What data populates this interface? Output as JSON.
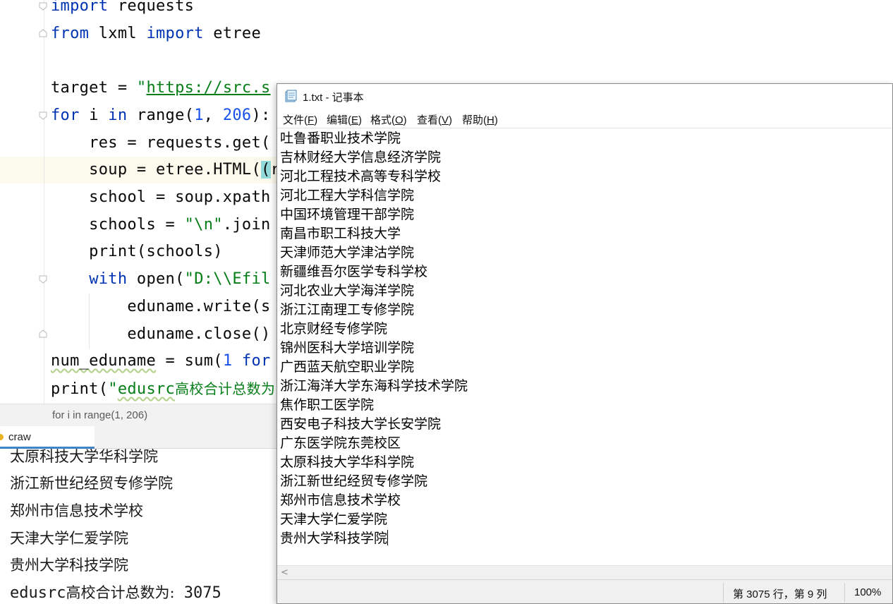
{
  "editor": {
    "lines": [
      [
        [
          "kw",
          "import"
        ],
        [
          "t",
          " requests"
        ]
      ],
      [
        [
          "kw",
          "from"
        ],
        [
          "t",
          " lxml "
        ],
        [
          "kw",
          "import"
        ],
        [
          "t",
          " etree"
        ]
      ],
      [],
      [
        [
          "t",
          "target = "
        ],
        [
          "str",
          "\""
        ],
        [
          "url",
          "https://src.s"
        ]
      ],
      [
        [
          "kw",
          "for"
        ],
        [
          "t",
          " i "
        ],
        [
          "kw",
          "in"
        ],
        [
          "t",
          " range("
        ],
        [
          "num",
          "1"
        ],
        [
          "t",
          ", "
        ],
        [
          "num",
          "206"
        ],
        [
          "t",
          "):"
        ]
      ],
      [
        [
          "t",
          "    res = requests.get("
        ]
      ],
      [
        [
          "t",
          "    soup = etree.HTML("
        ],
        [
          "hl",
          "("
        ],
        [
          "t",
          "r"
        ]
      ],
      [
        [
          "t",
          "    school = soup.xpath"
        ]
      ],
      [
        [
          "t",
          "    schools = "
        ],
        [
          "str",
          "\"\\n\""
        ],
        [
          "t",
          ".join"
        ]
      ],
      [
        [
          "t",
          "    print(schools)"
        ]
      ],
      [
        [
          "t",
          "    "
        ],
        [
          "kw",
          "with"
        ],
        [
          "t",
          " open("
        ],
        [
          "str",
          "\"D:\\\\Efil"
        ]
      ],
      [
        [
          "t",
          "        eduname.write(s"
        ]
      ],
      [
        [
          "t",
          "        eduname.close()"
        ]
      ],
      [
        [
          "sq",
          "num_eduname"
        ],
        [
          "t",
          " = sum("
        ],
        [
          "num",
          "1"
        ],
        [
          "t",
          " "
        ],
        [
          "kw",
          "for"
        ]
      ],
      [
        [
          "t",
          "print("
        ],
        [
          "str",
          "\""
        ],
        [
          "strsq",
          "edusrc"
        ],
        [
          "strcn",
          "高校合计总数为"
        ]
      ]
    ]
  },
  "breadcrumb": "for i in range(1, 206)",
  "run_panel": {
    "tab_label": "craw",
    "console_lines": [
      "太原科技大学华科学院",
      "浙江新世纪经贸专修学院",
      "郑州市信息技术学校",
      "天津大学仁爱学院",
      "贵州大学科技学院"
    ],
    "total_line_prefix": "edusrc",
    "total_line_cn": "高校合计总数为:",
    "total_line_value": " 3075"
  },
  "notepad": {
    "title": "1.txt - 记事本",
    "icon": "notepad-icon",
    "menu": [
      {
        "label": "文件(",
        "key": "F",
        "suffix": ")"
      },
      {
        "label": "编辑(",
        "key": "E",
        "suffix": ")"
      },
      {
        "label": "格式(",
        "key": "O",
        "suffix": ")"
      },
      {
        "label": "查看(",
        "key": "V",
        "suffix": ")"
      },
      {
        "label": "帮助(",
        "key": "H",
        "suffix": ")"
      }
    ],
    "lines": [
      "吐鲁番职业技术学院",
      "吉林财经大学信息经济学院",
      "河北工程技术高等专科学校",
      "河北工程大学科信学院",
      "中国环境管理干部学院",
      "南昌市职工科技大学",
      "天津师范大学津沽学院",
      "新疆维吾尔医学专科学校",
      "河北农业大学海洋学院",
      "浙江江南理工专修学院",
      "北京财经专修学院",
      "锦州医科大学培训学院",
      "广西蓝天航空职业学院",
      "浙江海洋大学东海科学技术学院",
      "焦作职工医学院",
      "西安电子科技大学长安学院",
      "广东医学院东莞校区",
      "太原科技大学华科学院",
      "浙江新世纪经贸专修学院",
      "郑州市信息技术学校",
      "天津大学仁爱学院",
      "贵州大学科技学院"
    ],
    "status": {
      "position": "第 3075 行，第 9 列",
      "zoom": "100%"
    },
    "hscroll_arrow": "<"
  }
}
